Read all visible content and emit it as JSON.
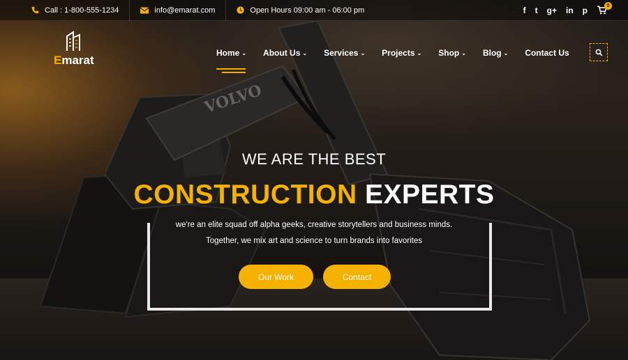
{
  "topbar": {
    "phone": "Call : 1-800-555-1234",
    "email": "info@emarat.com",
    "hours": "Open Hours 09:00 am - 06:00 pm",
    "social": [
      "f",
      "t",
      "g+",
      "in",
      "p"
    ],
    "cart_count": "0"
  },
  "logo": {
    "text_first": "E",
    "text_rest": "marat"
  },
  "nav": {
    "items": [
      {
        "label": "Home"
      },
      {
        "label": "About Us"
      },
      {
        "label": "Services"
      },
      {
        "label": "Projects"
      },
      {
        "label": "Shop"
      },
      {
        "label": "Blog"
      },
      {
        "label": "Contact Us"
      }
    ]
  },
  "hero": {
    "subtitle": "WE ARE THE BEST",
    "title_accent": "CONSTRUCTION",
    "title_rest": "EXPERTS",
    "desc_line1": "we're an elite squad off alpha geeks, creative storytellers and business minds.",
    "desc_line2": "Together, we mix art and science to turn brands into favorites",
    "btn_work": "Our Work",
    "btn_contact": "Contact",
    "excavator_label": "VOLVO"
  },
  "colors": {
    "accent": "#f5b100"
  }
}
